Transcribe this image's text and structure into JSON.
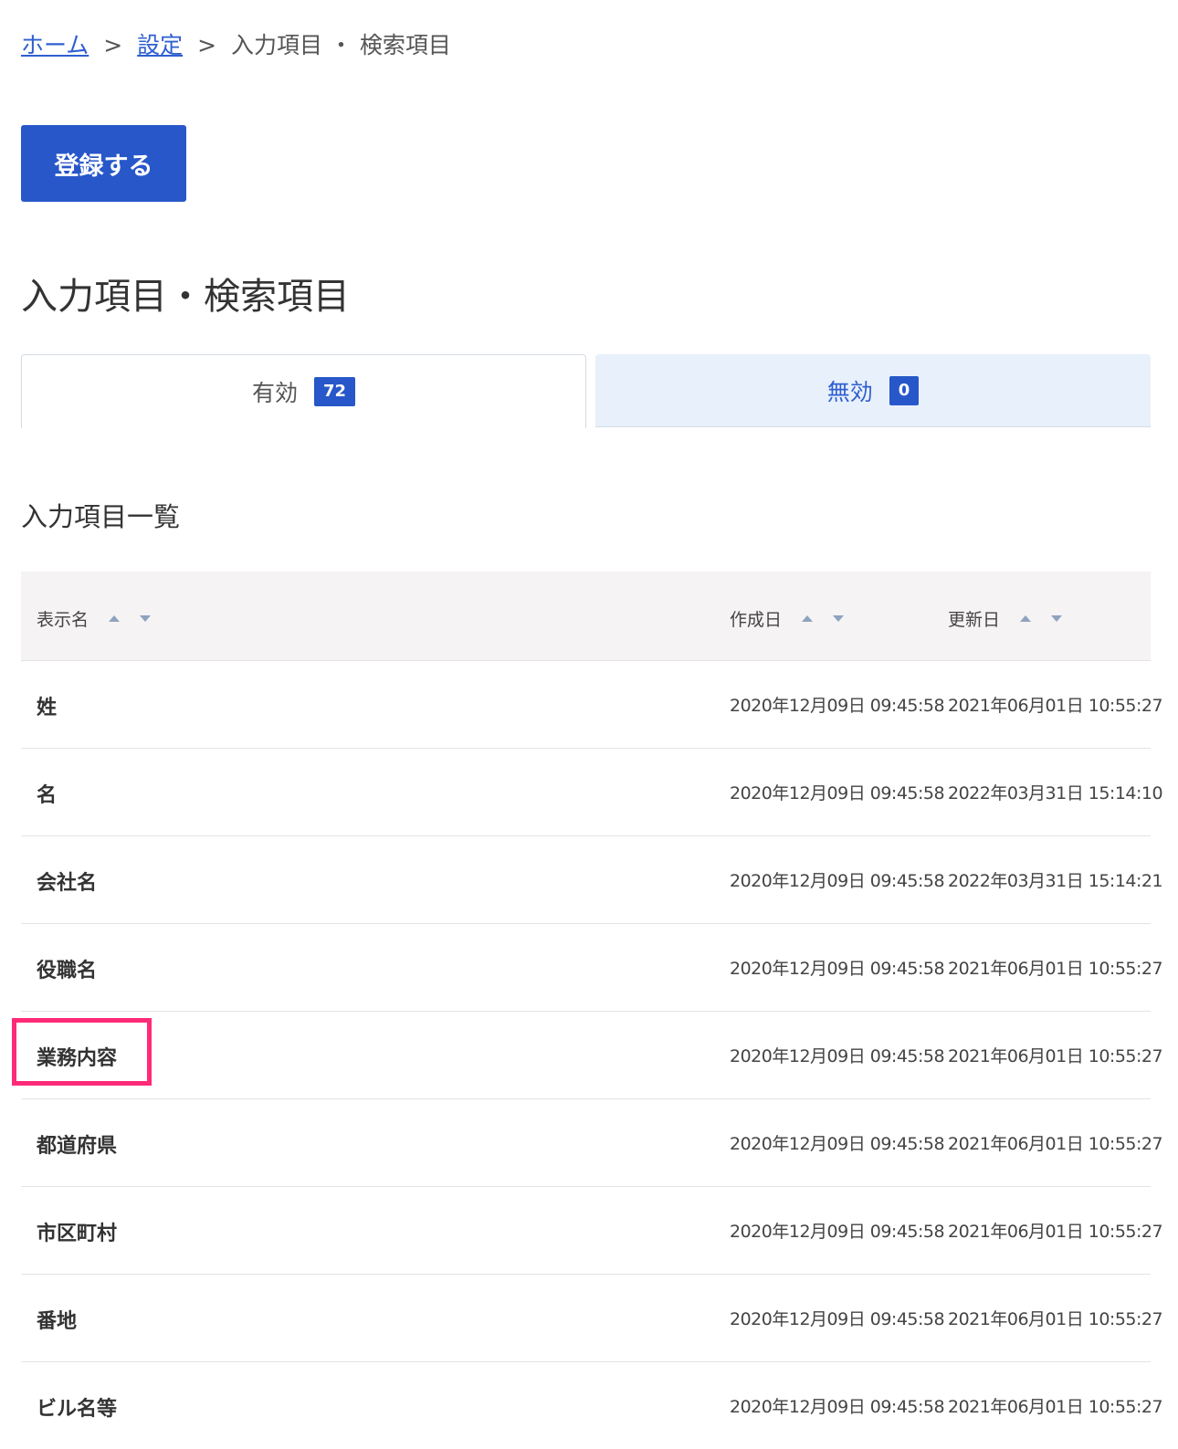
{
  "breadcrumb": {
    "home": "ホーム",
    "separator": ">",
    "settings": "設定",
    "current": "入力項目 ・ 検索項目"
  },
  "register_button": "登録する",
  "page_title": "入力項目・検索項目",
  "tabs": [
    {
      "label": "有効",
      "count": "72"
    },
    {
      "label": "無効",
      "count": "0"
    }
  ],
  "list_title": "入力項目一覧",
  "table": {
    "headers": {
      "name": "表示名",
      "created": "作成日",
      "updated": "更新日"
    },
    "rows": [
      {
        "name": "姓",
        "created": "2020年12月09日 09:45:58",
        "updated": "2021年06月01日 10:55:27"
      },
      {
        "name": "名",
        "created": "2020年12月09日 09:45:58",
        "updated": "2022年03月31日 15:14:10"
      },
      {
        "name": "会社名",
        "created": "2020年12月09日 09:45:58",
        "updated": "2022年03月31日 15:14:21"
      },
      {
        "name": "役職名",
        "created": "2020年12月09日 09:45:58",
        "updated": "2021年06月01日 10:55:27"
      },
      {
        "name": "業務内容",
        "created": "2020年12月09日 09:45:58",
        "updated": "2021年06月01日 10:55:27"
      },
      {
        "name": "都道府県",
        "created": "2020年12月09日 09:45:58",
        "updated": "2021年06月01日 10:55:27"
      },
      {
        "name": "市区町村",
        "created": "2020年12月09日 09:45:58",
        "updated": "2021年06月01日 10:55:27"
      },
      {
        "name": "番地",
        "created": "2020年12月09日 09:45:58",
        "updated": "2021年06月01日 10:55:27"
      },
      {
        "name": "ビル名等",
        "created": "2020年12月09日 09:45:58",
        "updated": "2021年06月01日 10:55:27"
      }
    ]
  },
  "colors": {
    "accent": "#2757c9",
    "link": "#2f5fd0",
    "highlight": "#ff2a78",
    "inactive_tab_bg": "#e8f0fb",
    "header_bg": "#f5f3f3"
  }
}
